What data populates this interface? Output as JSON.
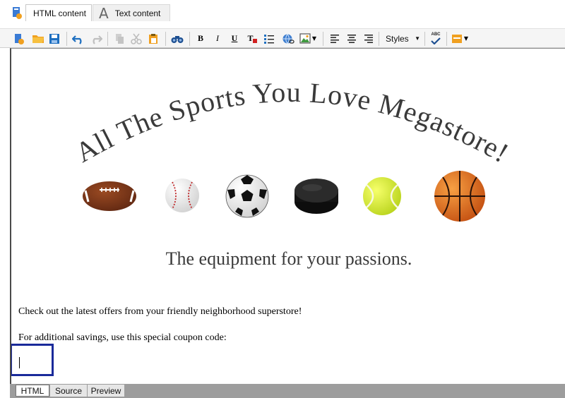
{
  "tabs": [
    {
      "label": "HTML content",
      "icon": "html-doc-icon",
      "active": true
    },
    {
      "label": "Text content",
      "icon": "letter-a-icon",
      "active": false
    }
  ],
  "toolbar": {
    "styles_label": "Styles",
    "bold": "B",
    "italic": "I",
    "underline": "U",
    "clear_format": "T",
    "spell_label": "ABC"
  },
  "content": {
    "headline": "All The Sports You Love Megastore!",
    "tagline": "The equipment for your passions.",
    "para1": "Check out the latest offers from your friendly neighborhood superstore!",
    "para2": "For additional savings, use this special coupon code:",
    "balls": [
      "football",
      "baseball",
      "soccer-ball",
      "hockey-puck",
      "tennis-ball",
      "basketball"
    ]
  },
  "bottom_tabs": [
    {
      "label": "HTML",
      "active": true
    },
    {
      "label": "Source",
      "active": false
    },
    {
      "label": "Preview",
      "active": false
    }
  ],
  "colors": {
    "accent": "#1a2a9a",
    "toolbar_orange": "#f0a020",
    "toolbar_blue": "#1e6fc0"
  }
}
